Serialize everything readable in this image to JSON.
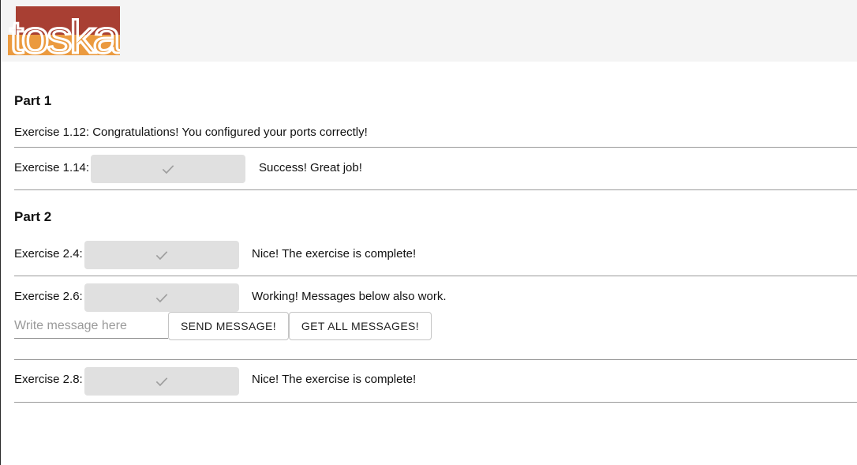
{
  "logo": {
    "text": "toska",
    "colors": {
      "red": "#a83f33",
      "orange": "#eb9a3f",
      "white": "#ffffff"
    }
  },
  "part1": {
    "title": "Part 1",
    "exercise_1_12": {
      "label": "Exercise 1.12: Congratulations! You configured your ports correctly!"
    },
    "exercise_1_14": {
      "label": "Exercise 1.14:",
      "status": "Success! Great job!"
    }
  },
  "part2": {
    "title": "Part 2",
    "exercise_2_4": {
      "label": "Exercise 2.4:",
      "status": "Nice! The exercise is complete!"
    },
    "exercise_2_6": {
      "label": "Exercise 2.6:",
      "status": "Working! Messages below also work.",
      "message_placeholder": "Write message here",
      "send_label": "SEND MESSAGE!",
      "get_all_label": "GET ALL MESSAGES!"
    },
    "exercise_2_8": {
      "label": "Exercise 2.8:",
      "status": "Nice! The exercise is complete!"
    }
  },
  "icons": {
    "check": "check-icon"
  },
  "colors": {
    "header_bg": "#f4f4f4",
    "button_bg": "#e0e0e0",
    "check": "#9e9e9e",
    "divider": "#9a9a9a"
  }
}
